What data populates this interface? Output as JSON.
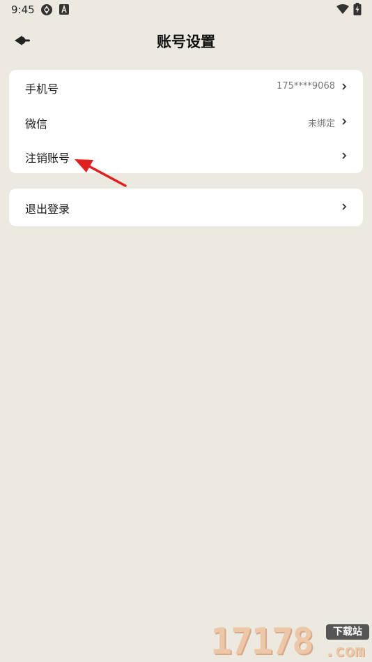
{
  "status_bar": {
    "time": "9:45",
    "icons": [
      "settings-app-icon",
      "notification-a-icon",
      "wifi-icon",
      "battery-charging-icon"
    ]
  },
  "header": {
    "title": "账号设置",
    "back_icon": "back-arrow-icon"
  },
  "account_card": {
    "items": [
      {
        "label": "手机号",
        "value": "175****9068"
      },
      {
        "label": "微信",
        "value": "未绑定"
      },
      {
        "label": "注销账号",
        "value": ""
      }
    ]
  },
  "logout_card": {
    "label": "退出登录"
  },
  "annotation": {
    "type": "red-arrow",
    "color": "#E02020",
    "points_to": "注销账号"
  },
  "watermark": {
    "digits": "17178",
    "badge": "下载站",
    "suffix": ".com"
  },
  "colors": {
    "background": "#ECE9E1",
    "card": "#FFFFFF",
    "value_text": "#777777"
  }
}
